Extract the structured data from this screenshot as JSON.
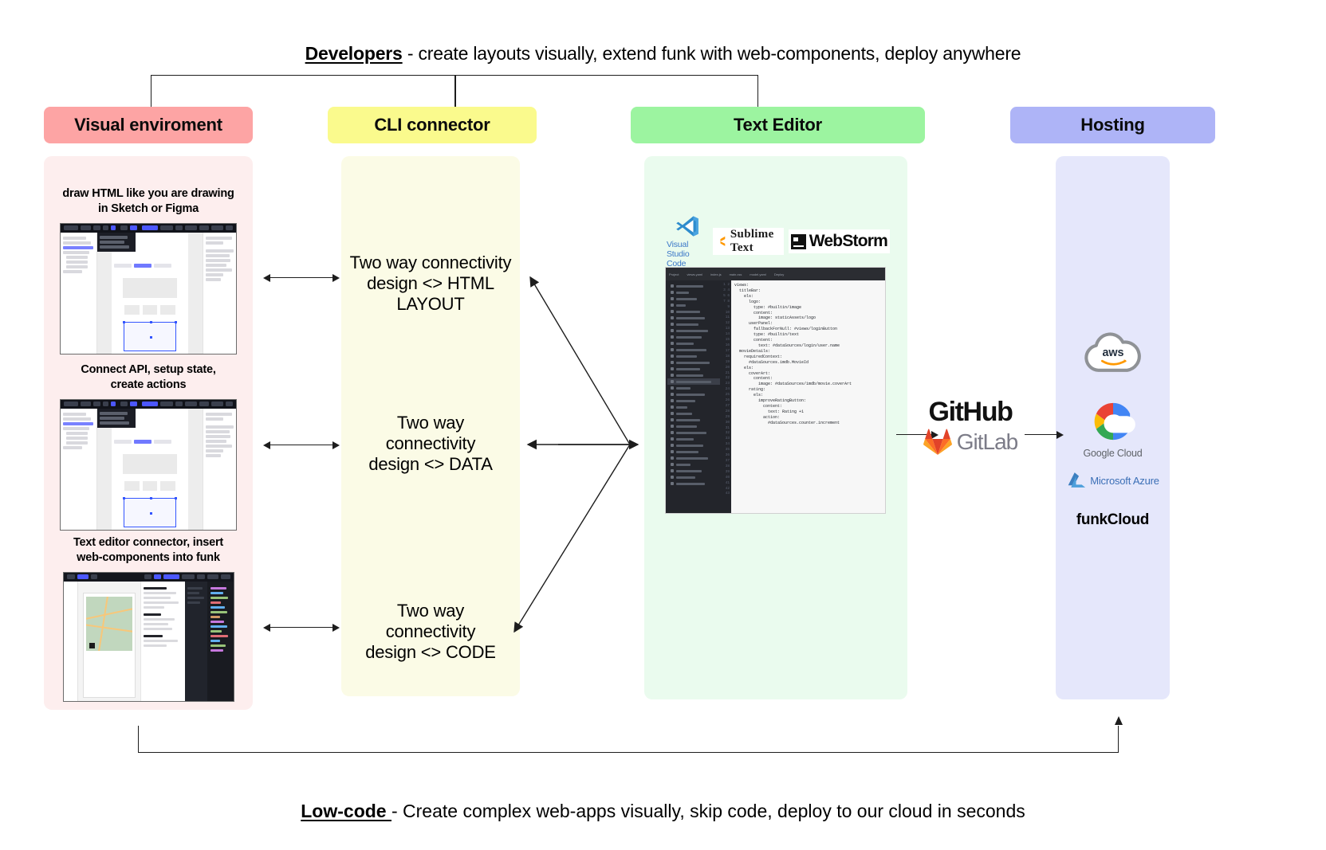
{
  "top_caption": {
    "lead": "Developers",
    "rest": " - create layouts visually, extend funk with web-components, deploy anywhere"
  },
  "bottom_caption": {
    "lead": "Low-code ",
    "rest": "- Create complex web-apps visually, skip code, deploy to our cloud in seconds"
  },
  "columns": {
    "visual": {
      "title": "Visual enviroment",
      "color": "#fda4a4",
      "panel_color": "#fdeeee"
    },
    "cli": {
      "title": "CLI connector",
      "color": "#fafa8d",
      "panel_color": "#fbfbe6"
    },
    "editor": {
      "title": "Text Editor",
      "color": "#9cf4a0",
      "panel_color": "#eafbee"
    },
    "hosting": {
      "title": "Hosting",
      "color": "#aeb4f7",
      "panel_color": "#e5e7fb"
    }
  },
  "visual_items": [
    {
      "caption_line1": "draw HTML like you are drawing",
      "caption_line2": "in Sketch or Figma"
    },
    {
      "caption_line1": "Connect API, setup state,",
      "caption_line2": "create actions"
    },
    {
      "caption_line1": "Text editor connector, insert",
      "caption_line2": "web-components into funk"
    }
  ],
  "cli_items": [
    {
      "line1": "Two way connectivity",
      "line2": "design <> HTML",
      "line3": "LAYOUT"
    },
    {
      "line1": "Two way",
      "line2": "connectivity",
      "line3": "design <> DATA"
    },
    {
      "line1": "Two way",
      "line2": "connectivity",
      "line3": "design <> CODE"
    }
  ],
  "editor_logos": [
    {
      "name": "Visual Studio Code"
    },
    {
      "name": "Sublime Text"
    },
    {
      "name": "WebStorm"
    }
  ],
  "code_snippet": "views:\n  titleBar:\n    els:\n      logo:\n        type: #builtin/image\n        content:\n          image: staticAssets/logo\n      userPanel:\n        fallbackForNull: #views/loginButton\n        type: #builtin/text\n        content:\n          text: #dataSources/login/user.name\n  movieDetails:\n    requiredContext:\n      #dataSources.imdb.MovieId\n    els:\n      coverArt:\n        content:\n          image: #dataSources/imdb/movie.coverArt\n      rating:\n        els:\n          improveRatingButton:\n            content:\n              text: Rating +1\n            action:\n              #dataSources.counter.increment",
  "code_line_numbers": "1\n2\n3\n4\n5\n6\n7\n8\n9\n10\n11\n12\n13\n14\n15\n16\n17\n18\n19\n20\n21\n22\n23\n24\n25\n26\n27\n28\n29\n30\n31\n32\n33\n34\n35\n36\n37\n38\n39\n40\n41\n42\n43",
  "code_editor_tab": "Project",
  "git": {
    "github": "GitHub",
    "gitlab": "GitLab"
  },
  "hosting_items": [
    {
      "name": "aws",
      "label": "aws"
    },
    {
      "name": "google-cloud",
      "label": "Google Cloud"
    },
    {
      "name": "microsoft-azure",
      "label": "Microsoft Azure"
    },
    {
      "name": "funkcloud",
      "label": "funkCloud"
    }
  ]
}
